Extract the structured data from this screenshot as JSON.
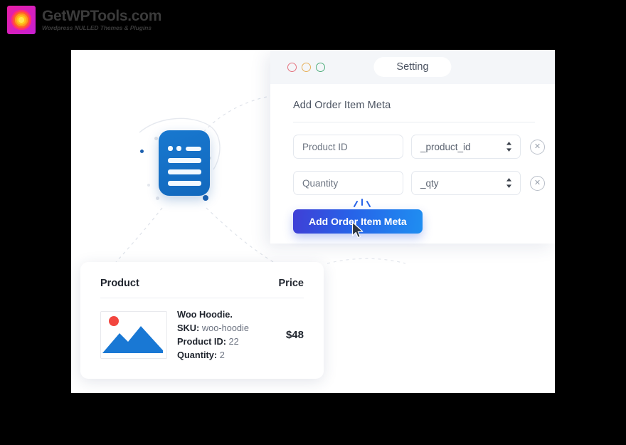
{
  "brand": {
    "title": "GetWPTools.com",
    "tagline": "Wordpress NULLED Themes & Plugins",
    "logo_icon": "sunburst-logo-icon",
    "colors": {
      "magenta": "#e81fa6",
      "yellow": "#ffe74d"
    }
  },
  "illustration": {
    "icon": "document-icon"
  },
  "window": {
    "traffic_lights": [
      "close-red",
      "minimize-yellow",
      "maximize-green"
    ],
    "tab_label": "Setting",
    "form": {
      "title": "Add Order Item Meta",
      "rows": [
        {
          "label_value": "Product ID",
          "label_placeholder": "Product ID",
          "meta_key": "_product_id",
          "stepper_icon": "stepper-updown-icon",
          "remove_icon": "remove-circle-icon"
        },
        {
          "label_value": "Quantity",
          "label_placeholder": "Quantity",
          "meta_key": "_qty",
          "stepper_icon": "stepper-updown-icon",
          "remove_icon": "remove-circle-icon"
        }
      ],
      "submit_label": "Add Order Item Meta",
      "submit_gradient": [
        "#3f3fd6",
        "#1f8ef1"
      ],
      "cursor_icon": "mouse-cursor-icon",
      "click_spark_icon": "click-spark-icon"
    }
  },
  "product_card": {
    "columns": {
      "product": "Product",
      "price": "Price"
    },
    "item": {
      "thumbnail_icon": "image-placeholder-icon",
      "name": "Woo Hoodie.",
      "sku_label": "SKU:",
      "sku_value": "woo-hoodie",
      "product_id_label": "Product ID:",
      "product_id_value": "22",
      "quantity_label": "Quantity:",
      "quantity_value": "2",
      "price": "$48"
    }
  }
}
